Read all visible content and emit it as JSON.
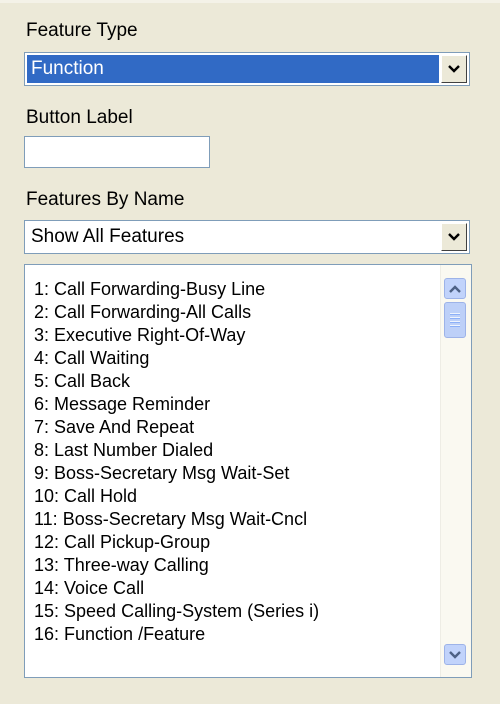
{
  "feature_type": {
    "label": "Feature Type",
    "value": "Function"
  },
  "button_label": {
    "label": "Button Label",
    "value": ""
  },
  "features_by_name": {
    "label": "Features By Name",
    "value": "Show All Features"
  },
  "features_list": {
    "items": [
      "1: Call Forwarding-Busy Line",
      "2: Call Forwarding-All Calls",
      "3: Executive Right-Of-Way",
      "4: Call Waiting",
      "5: Call Back",
      "6: Message Reminder",
      "7: Save And Repeat",
      "8: Last Number Dialed",
      "9: Boss-Secretary Msg Wait-Set",
      "10: Call Hold",
      "11: Boss-Secretary Msg Wait-Cncl",
      "12: Call Pickup-Group",
      "13: Three-way Calling",
      "14: Voice Call",
      "15: Speed Calling-System (Series i)",
      "16: Function /Feature"
    ]
  },
  "icons": {
    "dropdown": "chevron-down-icon",
    "scroll_up": "chevron-up-icon",
    "scroll_down": "chevron-down-icon",
    "thumb_grip": "grip-icon"
  },
  "colors": {
    "selection": "#316AC5",
    "face": "#ECE9D8",
    "border": "#7F9DB9"
  }
}
